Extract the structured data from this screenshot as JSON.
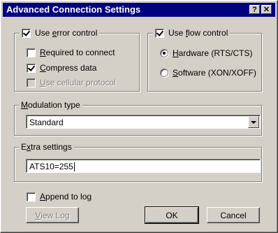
{
  "dialog": {
    "title": "Advanced Connection Settings",
    "help_glyph": "?",
    "close_glyph": "✕"
  },
  "error_control": {
    "legend_pre": "Use ",
    "legend_key": "e",
    "legend_post": "rror control",
    "checked": true,
    "options": [
      {
        "key": "R",
        "rest": "equired to connect",
        "checked": false,
        "enabled": true
      },
      {
        "key": "C",
        "rest": "ompress data",
        "checked": true,
        "enabled": true
      },
      {
        "key": "U",
        "rest": "se cellular protocol",
        "checked": false,
        "enabled": false
      }
    ]
  },
  "flow_control": {
    "legend_pre": "Use ",
    "legend_key": "f",
    "legend_post": "low control",
    "checked": true,
    "options": [
      {
        "key": "H",
        "rest": "ardware (RTS/CTS)",
        "selected": true
      },
      {
        "key": "S",
        "rest": "oftware (XON/XOFF)",
        "selected": false
      }
    ]
  },
  "modulation": {
    "label_key": "M",
    "label_rest": "odulation type",
    "value": "Standard"
  },
  "extra": {
    "label_pre": "E",
    "label_key": "x",
    "label_post": "tra settings",
    "value": "ATS10=255"
  },
  "append_log": {
    "key": "A",
    "rest": "ppend to log",
    "checked": false
  },
  "buttons": {
    "view_log_key": "V",
    "view_log_rest": "iew Log",
    "view_log_enabled": false,
    "ok": "OK",
    "cancel": "Cancel"
  }
}
